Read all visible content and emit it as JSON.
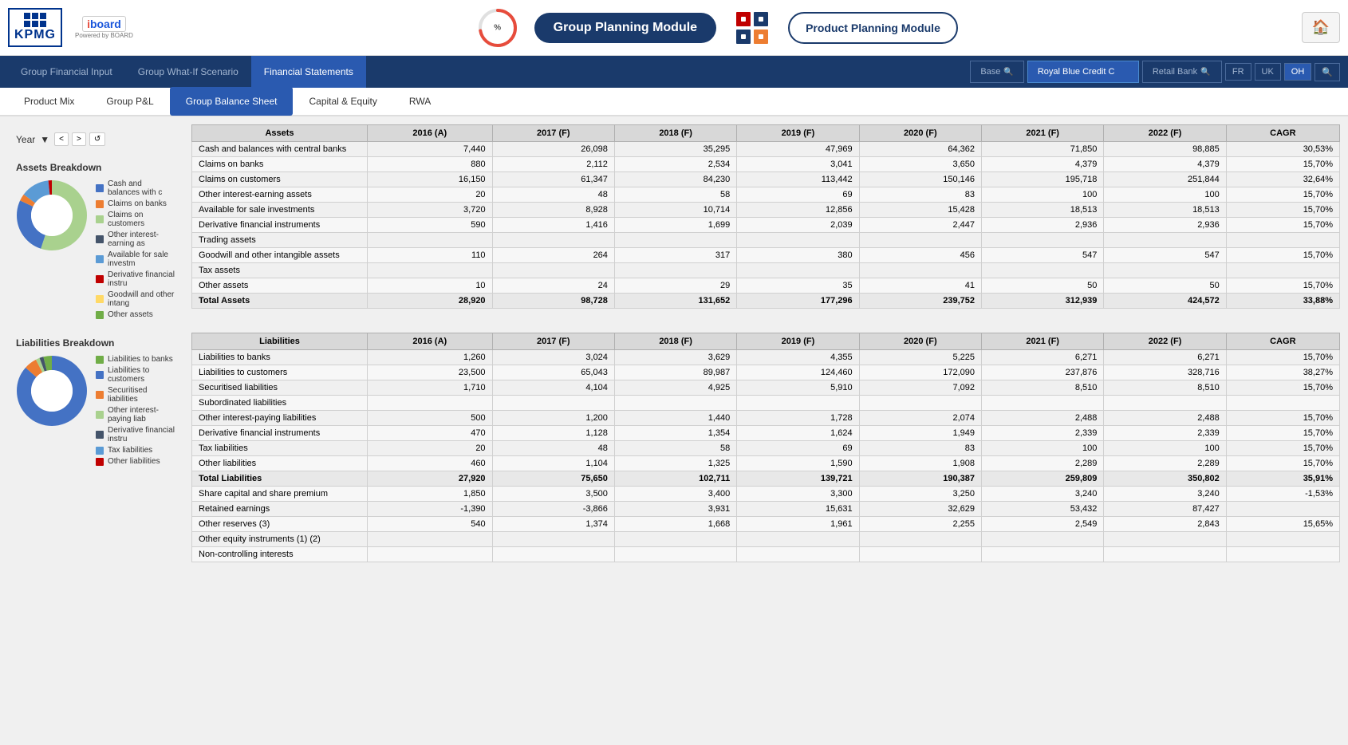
{
  "header": {
    "kpmg_label": "KPMG",
    "board_label": "board",
    "board_sub": "Powered by BOARD",
    "progress_label": "%",
    "group_planning_btn": "Group Planning Module",
    "product_planning_btn": "Product  Planning Module",
    "home_icon": "🏠"
  },
  "navbar": {
    "items": [
      {
        "label": "Group Financial Input",
        "active": false
      },
      {
        "label": "Group What-If Scenario",
        "active": false
      },
      {
        "label": "Financial Statements",
        "active": true
      }
    ],
    "segments": [
      {
        "label": "Base",
        "active": false
      },
      {
        "label": "Royal Blue Credit C",
        "active": true
      },
      {
        "label": "Retail Bank",
        "active": false
      }
    ],
    "flags": [
      {
        "label": "FR",
        "active": false
      },
      {
        "label": "UK",
        "active": false
      },
      {
        "label": "OH",
        "active": true
      }
    ]
  },
  "subnav": {
    "items": [
      {
        "label": "Product Mix",
        "active": false
      },
      {
        "label": "Group P&L",
        "active": false
      },
      {
        "label": "Group Balance Sheet",
        "active": true
      },
      {
        "label": "Capital & Equity",
        "active": false
      },
      {
        "label": "RWA",
        "active": false
      }
    ]
  },
  "left_panel": {
    "year_label": "Year",
    "assets_breakdown_title": "Assets Breakdown",
    "assets_legend": [
      {
        "color": "#4472c4",
        "label": "Cash and balances with c"
      },
      {
        "color": "#ed7d31",
        "label": "Claims on banks"
      },
      {
        "color": "#a9d18e",
        "label": "Claims on customers"
      },
      {
        "color": "#44546a",
        "label": "Other interest-earning as"
      },
      {
        "color": "#5b9bd5",
        "label": "Available for sale investm"
      },
      {
        "color": "#c00000",
        "label": "Derivative financial instru"
      },
      {
        "color": "#ffd966",
        "label": "Goodwill and other intang"
      },
      {
        "color": "#70ad47",
        "label": "Other assets"
      }
    ],
    "liabilities_breakdown_title": "Liabilities Breakdown",
    "liabilities_legend": [
      {
        "color": "#70ad47",
        "label": "Liabilities to banks"
      },
      {
        "color": "#4472c4",
        "label": "Liabilities to customers"
      },
      {
        "color": "#ed7d31",
        "label": "Securitised liabilities"
      },
      {
        "color": "#a9d18e",
        "label": "Other interest-paying liab"
      },
      {
        "color": "#44546a",
        "label": "Derivative financial instru"
      },
      {
        "color": "#5b9bd5",
        "label": "Tax liabilities"
      },
      {
        "color": "#c00000",
        "label": "Other liabilities"
      }
    ]
  },
  "assets_table": {
    "title": "Assets",
    "columns": [
      "Assets",
      "2016 (A)",
      "2017 (F)",
      "2018 (F)",
      "2019 (F)",
      "2020 (F)",
      "2021 (F)",
      "2022 (F)",
      "CAGR"
    ],
    "rows": [
      {
        "label": "Cash and balances with central banks",
        "v2016": "7,440",
        "v2017": "26,098",
        "v2018": "35,295",
        "v2019": "47,969",
        "v2020": "64,362",
        "v2021": "71,850",
        "v2022": "98,885",
        "cagr": "30,53%"
      },
      {
        "label": "Claims on banks",
        "v2016": "880",
        "v2017": "2,112",
        "v2018": "2,534",
        "v2019": "3,041",
        "v2020": "3,650",
        "v2021": "4,379",
        "v2022": "4,379",
        "cagr": "15,70%"
      },
      {
        "label": "Claims on customers",
        "v2016": "16,150",
        "v2017": "61,347",
        "v2018": "84,230",
        "v2019": "113,442",
        "v2020": "150,146",
        "v2021": "195,718",
        "v2022": "251,844",
        "cagr": "32,64%"
      },
      {
        "label": "Other interest-earning assets",
        "v2016": "20",
        "v2017": "48",
        "v2018": "58",
        "v2019": "69",
        "v2020": "83",
        "v2021": "100",
        "v2022": "100",
        "cagr": "15,70%"
      },
      {
        "label": "Available for sale investments",
        "v2016": "3,720",
        "v2017": "8,928",
        "v2018": "10,714",
        "v2019": "12,856",
        "v2020": "15,428",
        "v2021": "18,513",
        "v2022": "18,513",
        "cagr": "15,70%"
      },
      {
        "label": "Derivative financial instruments",
        "v2016": "590",
        "v2017": "1,416",
        "v2018": "1,699",
        "v2019": "2,039",
        "v2020": "2,447",
        "v2021": "2,936",
        "v2022": "2,936",
        "cagr": "15,70%"
      },
      {
        "label": "Trading assets",
        "v2016": "",
        "v2017": "",
        "v2018": "",
        "v2019": "",
        "v2020": "",
        "v2021": "",
        "v2022": "",
        "cagr": ""
      },
      {
        "label": "Goodwill and other intangible assets",
        "v2016": "110",
        "v2017": "264",
        "v2018": "317",
        "v2019": "380",
        "v2020": "456",
        "v2021": "547",
        "v2022": "547",
        "cagr": "15,70%"
      },
      {
        "label": "Tax assets",
        "v2016": "",
        "v2017": "",
        "v2018": "",
        "v2019": "",
        "v2020": "",
        "v2021": "",
        "v2022": "",
        "cagr": ""
      },
      {
        "label": "Other assets",
        "v2016": "10",
        "v2017": "24",
        "v2018": "29",
        "v2019": "35",
        "v2020": "41",
        "v2021": "50",
        "v2022": "50",
        "cagr": "15,70%"
      },
      {
        "label": "Total Assets",
        "v2016": "28,920",
        "v2017": "98,728",
        "v2018": "131,652",
        "v2019": "177,296",
        "v2020": "239,752",
        "v2021": "312,939",
        "v2022": "424,572",
        "cagr": "33,88%",
        "total": true
      }
    ]
  },
  "liabilities_table": {
    "title": "Liabilities",
    "columns": [
      "Liabilities",
      "2016 (A)",
      "2017 (F)",
      "2018 (F)",
      "2019 (F)",
      "2020 (F)",
      "2021 (F)",
      "2022 (F)",
      "CAGR"
    ],
    "rows": [
      {
        "label": "Liabilities to banks",
        "v2016": "1,260",
        "v2017": "3,024",
        "v2018": "3,629",
        "v2019": "4,355",
        "v2020": "5,225",
        "v2021": "6,271",
        "v2022": "6,271",
        "cagr": "15,70%"
      },
      {
        "label": "Liabilities to customers",
        "v2016": "23,500",
        "v2017": "65,043",
        "v2018": "89,987",
        "v2019": "124,460",
        "v2020": "172,090",
        "v2021": "237,876",
        "v2022": "328,716",
        "cagr": "38,27%"
      },
      {
        "label": "Securitised liabilities",
        "v2016": "1,710",
        "v2017": "4,104",
        "v2018": "4,925",
        "v2019": "5,910",
        "v2020": "7,092",
        "v2021": "8,510",
        "v2022": "8,510",
        "cagr": "15,70%"
      },
      {
        "label": "Subordinated liabilities",
        "v2016": "",
        "v2017": "",
        "v2018": "",
        "v2019": "",
        "v2020": "",
        "v2021": "",
        "v2022": "",
        "cagr": ""
      },
      {
        "label": "Other interest-paying liabilities",
        "v2016": "500",
        "v2017": "1,200",
        "v2018": "1,440",
        "v2019": "1,728",
        "v2020": "2,074",
        "v2021": "2,488",
        "v2022": "2,488",
        "cagr": "15,70%"
      },
      {
        "label": "Derivative financial instruments",
        "v2016": "470",
        "v2017": "1,128",
        "v2018": "1,354",
        "v2019": "1,624",
        "v2020": "1,949",
        "v2021": "2,339",
        "v2022": "2,339",
        "cagr": "15,70%"
      },
      {
        "label": "Tax liabilities",
        "v2016": "20",
        "v2017": "48",
        "v2018": "58",
        "v2019": "69",
        "v2020": "83",
        "v2021": "100",
        "v2022": "100",
        "cagr": "15,70%"
      },
      {
        "label": "Other liabilities",
        "v2016": "460",
        "v2017": "1,104",
        "v2018": "1,325",
        "v2019": "1,590",
        "v2020": "1,908",
        "v2021": "2,289",
        "v2022": "2,289",
        "cagr": "15,70%"
      },
      {
        "label": "Total Liabilities",
        "v2016": "27,920",
        "v2017": "75,650",
        "v2018": "102,711",
        "v2019": "139,721",
        "v2020": "190,387",
        "v2021": "259,809",
        "v2022": "350,802",
        "cagr": "35,91%",
        "total": true
      },
      {
        "label": "Share capital and share premium",
        "v2016": "1,850",
        "v2017": "3,500",
        "v2018": "3,400",
        "v2019": "3,300",
        "v2020": "3,250",
        "v2021": "3,240",
        "v2022": "3,240",
        "cagr": "-1,53%"
      },
      {
        "label": "Retained earnings",
        "v2016": "-1,390",
        "v2017": "-3,866",
        "v2018": "3,931",
        "v2019": "15,631",
        "v2020": "32,629",
        "v2021": "53,432",
        "v2022": "87,427",
        "cagr": ""
      },
      {
        "label": "Other reserves (3)",
        "v2016": "540",
        "v2017": "1,374",
        "v2018": "1,668",
        "v2019": "1,961",
        "v2020": "2,255",
        "v2021": "2,549",
        "v2022": "2,843",
        "cagr": "15,65%"
      },
      {
        "label": "Other equity instruments (1) (2)",
        "v2016": "",
        "v2017": "",
        "v2018": "",
        "v2019": "",
        "v2020": "",
        "v2021": "",
        "v2022": "",
        "cagr": ""
      },
      {
        "label": "Non-controlling interests",
        "v2016": "",
        "v2017": "",
        "v2018": "",
        "v2019": "",
        "v2020": "",
        "v2021": "",
        "v2022": "",
        "cagr": ""
      }
    ]
  }
}
